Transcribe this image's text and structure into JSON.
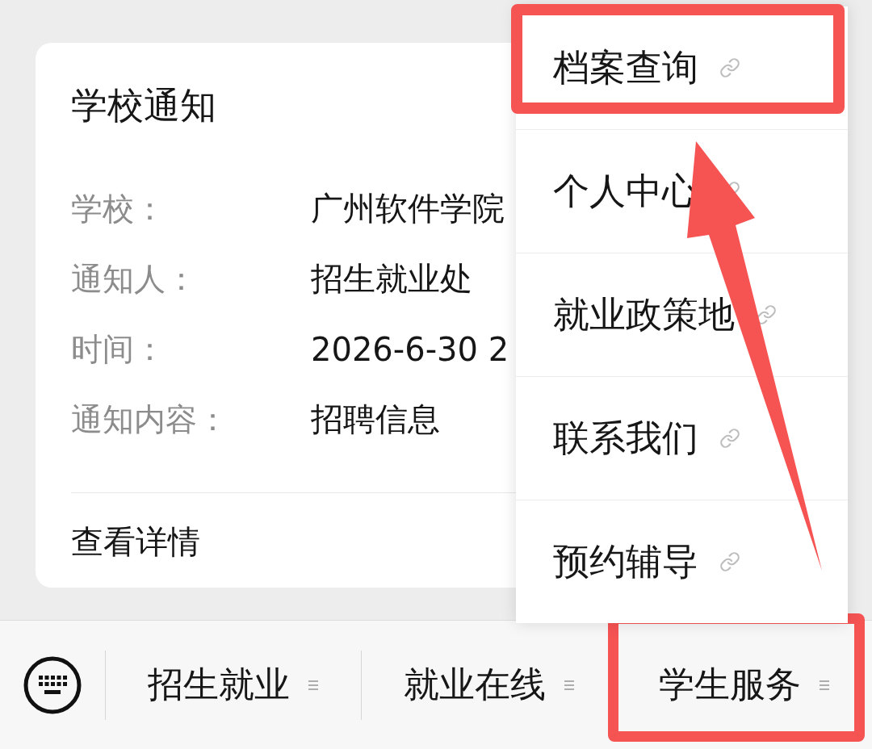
{
  "card": {
    "title": "学校通知",
    "fields": [
      {
        "label": "学校：",
        "value": "广州软件学院"
      },
      {
        "label": "通知人：",
        "value": "招生就业处"
      },
      {
        "label": "时间：",
        "value": "2026-6-30 2"
      },
      {
        "label": "通知内容：",
        "value": "招聘信息"
      }
    ],
    "link": "查看详情"
  },
  "popup_menu": {
    "items": [
      {
        "label": "档案查询",
        "highlighted": true
      },
      {
        "label": "个人中心",
        "highlighted": false
      },
      {
        "label": "就业政策地",
        "highlighted": false
      },
      {
        "label": "联系我们",
        "highlighted": false
      },
      {
        "label": "预约辅导",
        "highlighted": false
      }
    ]
  },
  "menu_bar": {
    "items": [
      {
        "label": "招生就业",
        "highlighted": false
      },
      {
        "label": "就业在线",
        "highlighted": false
      },
      {
        "label": "学生服务",
        "highlighted": true
      }
    ]
  },
  "annotation_arrow": true
}
